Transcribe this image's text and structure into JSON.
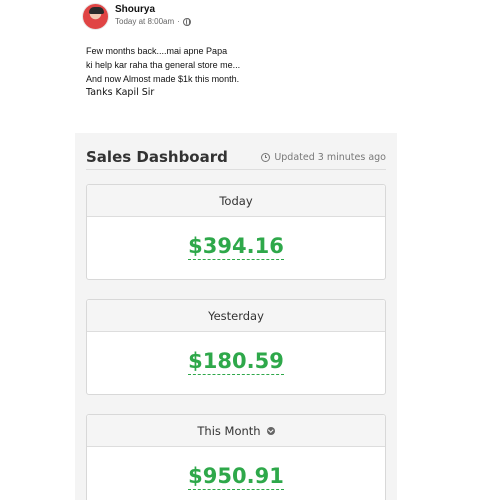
{
  "post": {
    "author": "Shourya",
    "timestamp": "Today at 8:00am",
    "separator": "·",
    "privacy_icon": "globe-icon",
    "lines": [
      "Few months back....mai apne Papa",
      "ki help kar raha tha general store me...",
      "And now Almost made $1k this month."
    ],
    "signoff": "Tanks Kapil Sir"
  },
  "dashboard": {
    "title": "Sales Dashboard",
    "updated": "Updated 3 minutes ago",
    "updated_icon": "clock-icon",
    "cards": [
      {
        "label": "Today",
        "value": "$394.16"
      },
      {
        "label": "Yesterday",
        "value": "$180.59"
      },
      {
        "label": "This Month",
        "value": "$950.91",
        "icon": "chevron-down-icon"
      }
    ],
    "colors": {
      "amount": "#2ea84a",
      "panel_bg": "#f4f4f4"
    }
  }
}
